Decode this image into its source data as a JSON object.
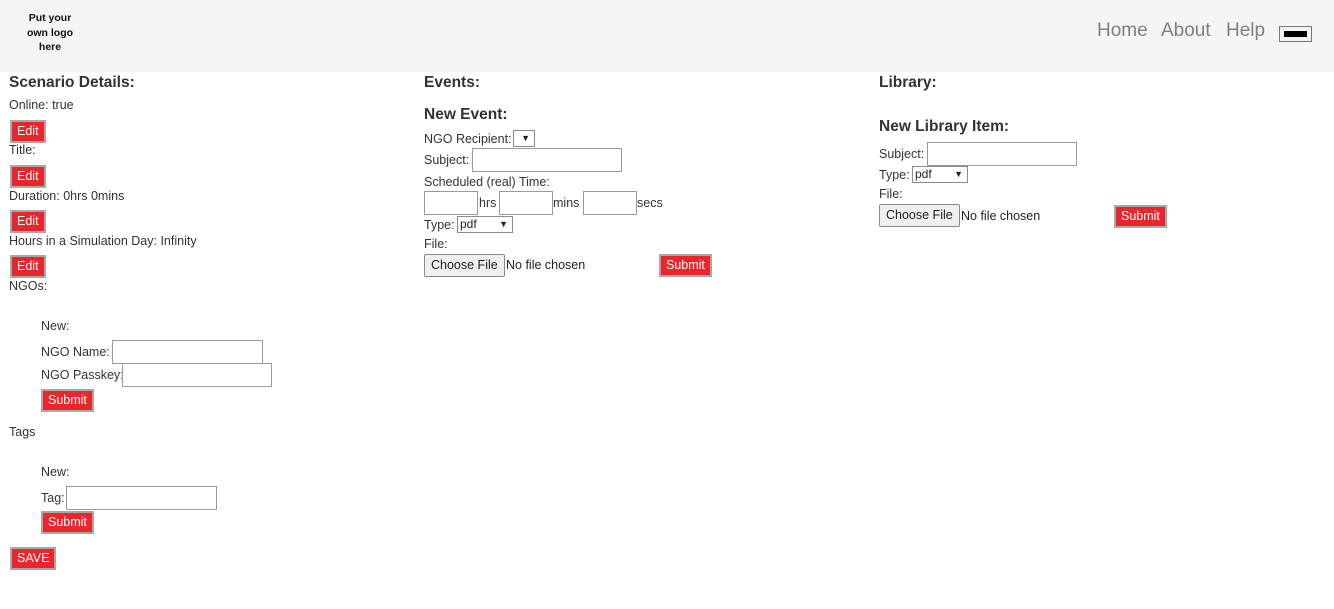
{
  "header": {
    "logo_text": "Put your\nown logo\nhere",
    "nav": [
      "Home",
      "About",
      "Help"
    ]
  },
  "scenario": {
    "heading": "Scenario Details:",
    "online": "Online: true",
    "title": "Title:",
    "duration": "Duration: 0hrs 0mins",
    "hours_per_day": "Hours in a Simulation Day: Infinity",
    "edit_label": "Edit",
    "ngos_label": "NGOs:",
    "ngo_new": "New:",
    "ngo_name_label": "NGO Name:",
    "ngo_passkey_label": "NGO Passkey:",
    "tags_label": "Tags",
    "tag_new": "New:",
    "tag_label": "Tag:",
    "submit_label": "Submit",
    "save_label": "SAVE"
  },
  "events": {
    "heading": "Events:",
    "new_heading": "New Event:",
    "ngo_recipient_label": "NGO Recipient:",
    "subject_label": "Subject:",
    "scheduled_label": "Scheduled (real) Time:",
    "hrs": "hrs",
    "mins": "mins",
    "secs": "secs",
    "type_label": "Type:",
    "type_value": "pdf",
    "file_label": "File:",
    "choose_file": "Choose File",
    "no_file": "No file chosen",
    "submit_label": "Submit"
  },
  "library": {
    "heading": "Library:",
    "new_heading": "New Library Item:",
    "subject_label": "Subject:",
    "type_label": "Type:",
    "type_value": "pdf",
    "file_label": "File:",
    "choose_file": "Choose File",
    "no_file": "No file chosen",
    "submit_label": "Submit"
  },
  "colors": {
    "accent_red": "#e8262b",
    "topbar_bg": "#f5f5f5",
    "nav_text": "#808080"
  },
  "icons": {
    "dropdown": "triangle-down",
    "menu": "hamburger-bar"
  }
}
